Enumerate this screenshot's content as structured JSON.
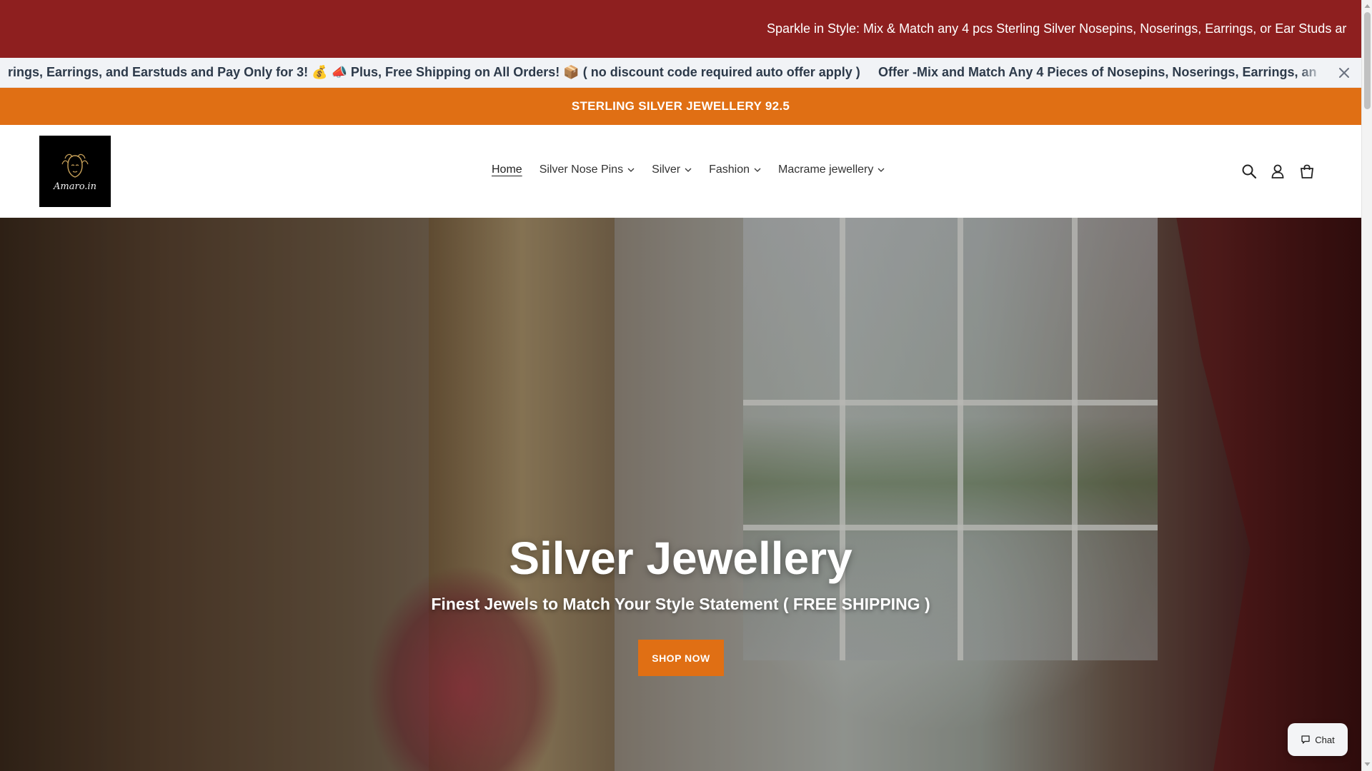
{
  "top_marquee": {
    "text": "Sparkle in Style: Mix & Match any 4 pcs Sterling Silver Nosepins, Noserings, Earrings, or Ear Studs ar"
  },
  "offer_marquee": {
    "text_a": "rings, Earrings, and Earstuds and Pay Only for 3! 💰 📣 Plus, Free Shipping on All Orders! 📦 ( no discount code required auto offer apply )",
    "text_b": "Offer -Mix and Match Any 4 Pieces of Nosepins, Noserings, Earrings, an",
    "close_icon": "close-icon"
  },
  "announcement": {
    "text": "STERLING SILVER JEWELLERY 92.5"
  },
  "header": {
    "logo_text": "Amaro.in",
    "nav": [
      {
        "label": "Home",
        "active": true
      },
      {
        "label": "Silver Nose Pins",
        "dropdown": true
      },
      {
        "label": "Silver",
        "dropdown": true
      },
      {
        "label": "Fashion",
        "dropdown": true
      },
      {
        "label": "Macrame jewellery",
        "dropdown": true
      }
    ],
    "icons": [
      "search-icon",
      "account-icon",
      "cart-icon"
    ]
  },
  "hero": {
    "title": "Silver Jewellery",
    "subtitle": "Finest Jewels to Match Your Style Statement ( FREE SHIPPING )",
    "button_label": "SHOP NOW"
  },
  "chat": {
    "label": "Chat"
  },
  "colors": {
    "top_bar": "#8e1f1f",
    "offer_bar": "#f1f3f6",
    "accent_orange": "#e06f14",
    "offer_text": "#2d3a4a"
  }
}
